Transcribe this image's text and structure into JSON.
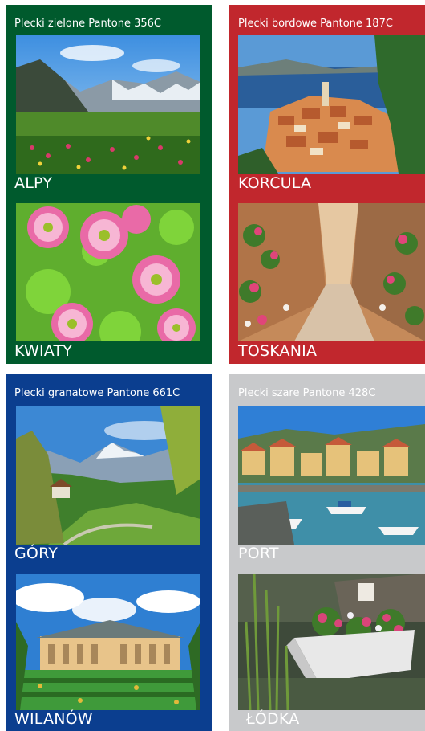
{
  "panels": [
    {
      "id": "green",
      "title": "Plecki zielone Pantone 356C",
      "bg": "#005A2D",
      "text_color": "#FFFFFF",
      "items": [
        {
          "caption": "ALPY",
          "image": "alpine-meadow-photo"
        },
        {
          "caption": "KWIATY",
          "image": "pink-green-flowers-photo"
        }
      ]
    },
    {
      "id": "burgundy",
      "title": "Plecki bordowe Pantone 187C",
      "bg": "#C1272D",
      "text_color": "#FFFFFF",
      "items": [
        {
          "caption": "KORCULA",
          "image": "korcula-town-photo"
        },
        {
          "caption": "TOSKANIA",
          "image": "tuscany-street-photo"
        }
      ]
    },
    {
      "id": "navy",
      "title": "Plecki granatowe Pantone 661C",
      "bg": "#0B3E8F",
      "text_color": "#FFFFFF",
      "items": [
        {
          "caption": "GÓRY",
          "image": "mountain-valley-photo"
        },
        {
          "caption": "WILANÓW",
          "image": "wilanow-palace-photo"
        }
      ]
    },
    {
      "id": "grey",
      "title": "Plecki szare Pantone 428C",
      "bg": "#C8C9CB",
      "text_color": "#FFFFFF",
      "items": [
        {
          "caption": "PORT",
          "image": "harbour-port-photo"
        },
        {
          "caption": "ŁÓDKA",
          "image": "boat-with-flowers-photo"
        }
      ]
    }
  ]
}
